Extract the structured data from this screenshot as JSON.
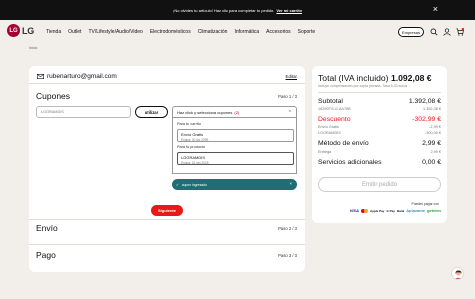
{
  "promo": {
    "text": "¡No olvides tu artículo! Haz clic para completar tu pedido.",
    "link": "Ver mi carrito"
  },
  "header": {
    "logo_mark": "LG",
    "logo_text": "LG",
    "menu": [
      "Tienda",
      "Outlet",
      "TV/Lifestyle/Audio/Video",
      "Electrodomésticos",
      "Climatización",
      "Informática",
      "Accesorios",
      "Soporte"
    ],
    "business_button": "Empresas",
    "cart_count": "1"
  },
  "breadcrumb": "Inicio",
  "checkout": {
    "email": "rubenarturo@gmail.com",
    "edit_label": "Editar",
    "coupons": {
      "title": "Cupones",
      "step": "Paso 1 / 3",
      "input_placeholder": "LGGRAMDIS",
      "apply_button": "utilizar",
      "select_label": "Haz click y selecciona cupones",
      "select_count": "(2)",
      "group_cart": "Para tu carrito",
      "group_product": "Para tu producto",
      "options": [
        {
          "title": "Envío Gratis",
          "sub": "Expira: 30 dic 2099"
        },
        {
          "title": "LGGRAMDIS",
          "sub": "Expira: 31 jan 2025"
        }
      ],
      "toast": "cupon ingresado",
      "next_button": "Siguiente"
    },
    "shipping": {
      "title": "Envío",
      "step": "Paso 2 / 3"
    },
    "payment": {
      "title": "Pago",
      "step": "Paso 3 / 3"
    }
  },
  "summary": {
    "total_label": "Total (IVA incluido)",
    "total_value": "1.092,08 €",
    "compensation": "Incluye compensación por copia privada. Tasa 5,33 euros",
    "subtotal_label": "Subtotal",
    "subtotal_value": "1.392,08 €",
    "item_code": "16Z90TS-G.AA78B",
    "item_value": "1.392,08 €",
    "discount_label": "Descuento",
    "discount_value": "-302,99 €",
    "free_ship_label": "Envío Gratis",
    "free_ship_value": "-2,99 €",
    "coupon_label": "LGGRAMDIS",
    "coupon_value": "-300,00 €",
    "ship_method_label": "Método de envío",
    "ship_method_value": "2,99 €",
    "delivery_label": "Entrega",
    "delivery_value": "2,99 €",
    "extra_label": "Servicios adicionales",
    "extra_value": "0,00 €",
    "emit_button": "Emitir pedido",
    "pay_with": "Puedes pagar con",
    "pay_logos": [
      "VISA",
      "Apple Pay",
      "G Pay",
      "Bank",
      "Aplazame",
      "getelen"
    ]
  },
  "colors": {
    "brand_red": "#a50034",
    "cta_red": "#ea1917",
    "toast_teal": "#216d75",
    "background": "#f2eee9"
  }
}
